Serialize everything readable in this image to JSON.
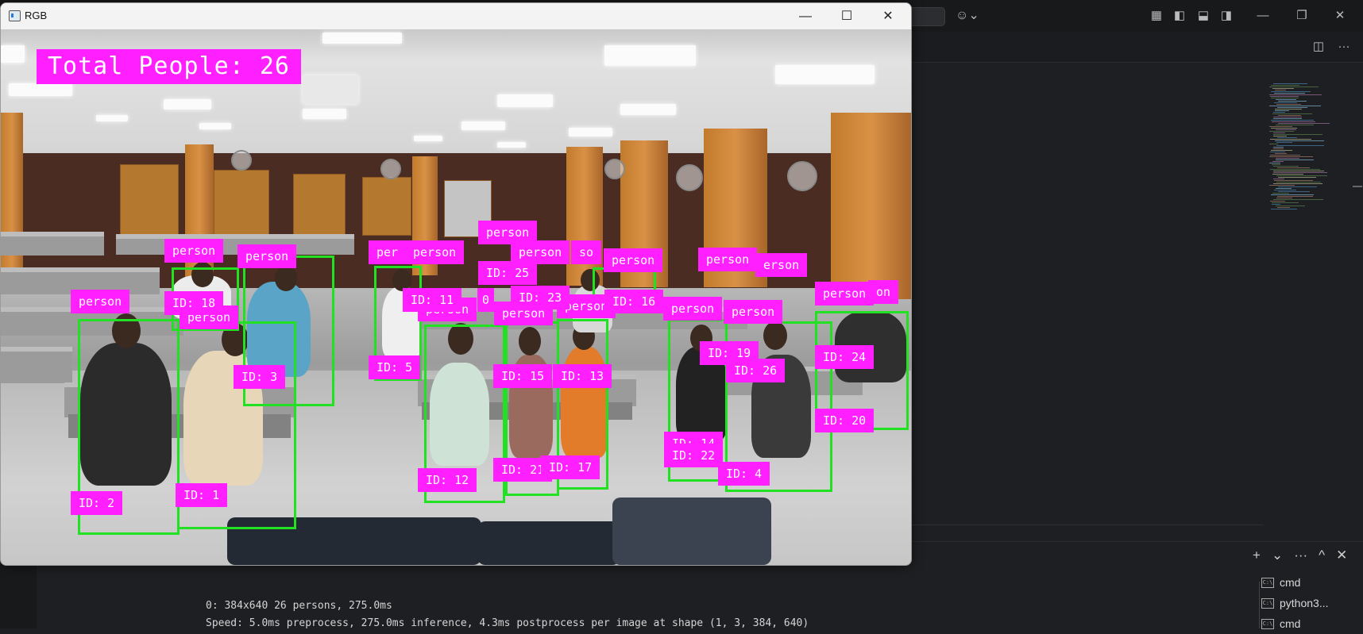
{
  "window": {
    "title": "RGB",
    "minimize_glyph": "—",
    "maximize_glyph": "☐",
    "close_glyph": "✕"
  },
  "overlay": {
    "total_people_text": "Total People: 26"
  },
  "detections": [
    {
      "label": "person",
      "id_text": "ID: 2"
    },
    {
      "label": "person",
      "id_text": "ID: 1"
    },
    {
      "label": "person",
      "id_text": "ID: 18"
    },
    {
      "label": "person",
      "id_text": "ID: 3"
    },
    {
      "label": "person",
      "id_text": "ID: 5"
    },
    {
      "label": "person",
      "id_text": "ID: 25"
    },
    {
      "label": "person",
      "id_text": "ID: 23"
    },
    {
      "label": "person",
      "id_text": "ID: 16"
    },
    {
      "label": "person",
      "id_text": "ID: 12"
    },
    {
      "label": "person",
      "id_text": "ID: 15"
    },
    {
      "label": "person",
      "id_text": "ID: 13"
    },
    {
      "label": "person",
      "id_text": "ID: 21"
    },
    {
      "label": "person",
      "id_text": "ID: 17"
    },
    {
      "label": "person",
      "id_text": "ID: 14"
    },
    {
      "label": "person",
      "id_text": "ID: 22"
    },
    {
      "label": "person",
      "id_text": "ID: 19"
    },
    {
      "label": "person",
      "id_text": "ID: 26"
    },
    {
      "label": "person",
      "id_text": "ID: 4"
    },
    {
      "label": "person",
      "id_text": "ID: 24"
    },
    {
      "label": "person",
      "id_text": "ID: 20"
    }
  ],
  "partial_labels": {
    "per": "per",
    "so": "so",
    "erson": "erson",
    "on": "on",
    "id_11": "ID: 11",
    "id_10": "0"
  },
  "ide": {
    "copilot_icon": "copilot-icon",
    "terminal_output": [
      "0: 384x640 26 persons, 275.0ms",
      "Speed: 5.0ms preprocess, 275.0ms inference, 4.3ms postprocess per image at shape (1, 3, 384, 640)"
    ],
    "terminals": [
      "cmd",
      "python3...",
      "cmd"
    ],
    "panel_tools": [
      "+",
      "⌄",
      "···",
      "^",
      "✕"
    ]
  },
  "colors": {
    "box_green": "#22e022",
    "label_magenta": "#ff1fff"
  }
}
